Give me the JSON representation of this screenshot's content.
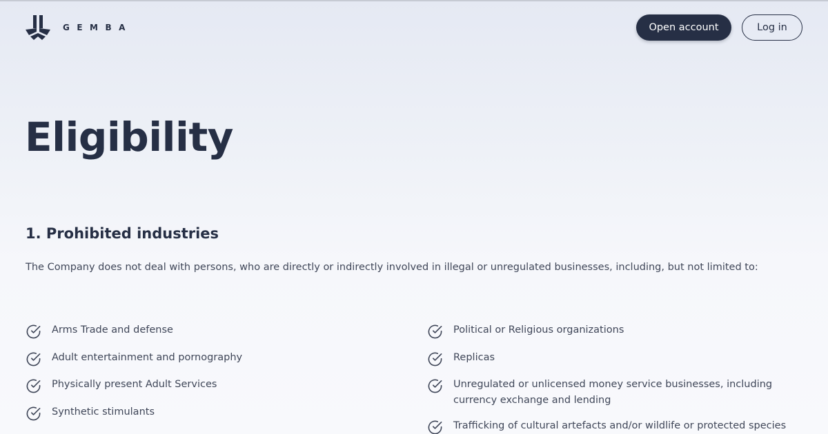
{
  "header": {
    "brand": "GEMBA",
    "open_account_label": "Open account",
    "login_label": "Log in"
  },
  "main": {
    "title": "Eligibility",
    "section": {
      "heading": "1. Prohibited industries",
      "intro": "The Company does not deal with persons, who are directly or indirectly involved in illegal or unregulated businesses, including, but not limited to:",
      "left_items": [
        "Arms Trade and defense",
        "Adult entertainment and pornography",
        "Physically present Adult Services",
        "Synthetic stimulants"
      ],
      "right_items": [
        "Political or Religious organizations",
        "Replicas",
        "Unregulated or unlicensed money service businesses, including currency exchange and lending",
        "Trafficking of cultural artefacts and/or wildlife or protected species"
      ],
      "item_icon": "check-circle-icon"
    }
  },
  "colors": {
    "primary": "#262f45",
    "body_text": "#3f4658",
    "background_top": "#e5e9f3",
    "background_bottom": "#f8f9fc"
  }
}
